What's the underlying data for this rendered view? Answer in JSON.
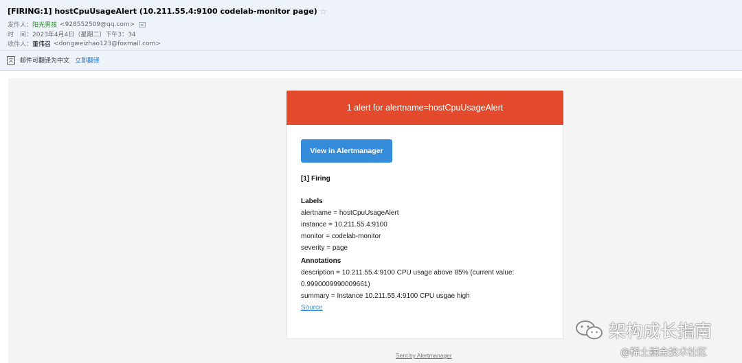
{
  "email": {
    "subject": "[FIRING:1] hostCpuUsageAlert (10.211.55.4:9100 codelab-monitor page)",
    "sender_label": "发件人：",
    "sender_name": "阳光男孩",
    "sender_address": "<928552509@qq.com>",
    "time_label": "时　间：",
    "time_value": "2023年4月4日（星期二）下午3：34",
    "recipient_label": "收件人：",
    "recipient_name": "董伟召",
    "recipient_address": "<dongweizhao123@foxmail.com>",
    "translate_text": "邮件可翻译为中文",
    "translate_link": "立即翻译"
  },
  "alert": {
    "banner": "1 alert for alertname=hostCpuUsageAlert",
    "button_label": "View in Alertmanager",
    "firing_heading": "[1] Firing",
    "labels_heading": "Labels",
    "labels": [
      "alertname = hostCpuUsageAlert",
      "instance = 10.211.55.4:9100",
      "monitor = codelab-monitor",
      "severity = page"
    ],
    "annotations_heading": "Annotations",
    "description_line1": "description = 10.211.55.4:9100 CPU usage above 85% (current value:",
    "description_line2": "0.9990009990009661)",
    "summary": "summary = Instance 10.211.55.4:9100 CPU usgae high",
    "source_link": "Source",
    "footer": "Sent by Alertmanager"
  },
  "watermark": {
    "title": "架构成长指南",
    "subtitle": "@稀土掘金技术社区"
  },
  "colors": {
    "banner": "#e24a2b",
    "button": "#348cdb",
    "header_bg": "#eef3fa"
  }
}
